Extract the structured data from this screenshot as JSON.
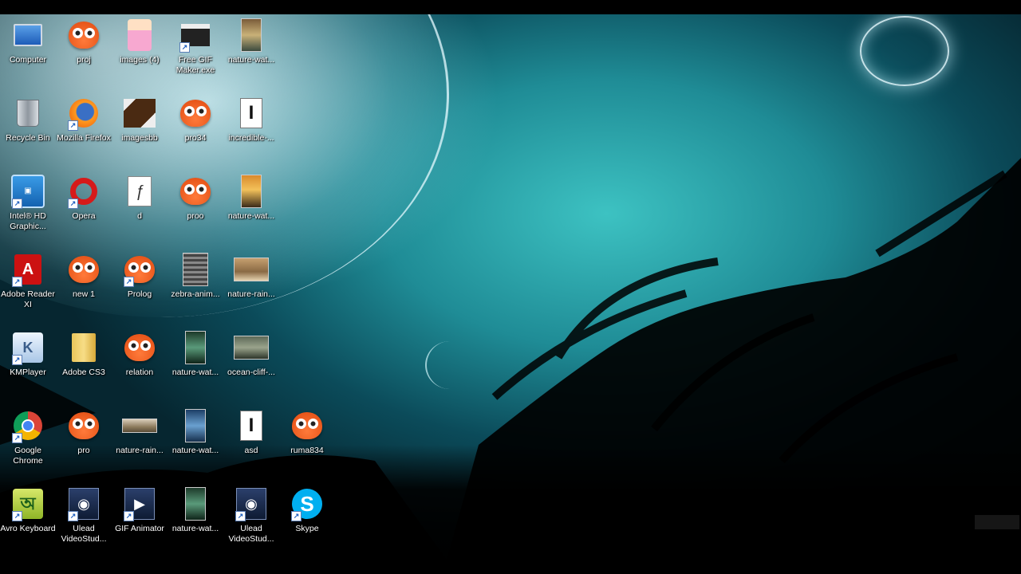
{
  "desktop": {
    "icons": [
      {
        "label": "Computer",
        "icon": "computer-icon",
        "shortcut": false
      },
      {
        "label": "proj",
        "icon": "owl-app-icon",
        "shortcut": false
      },
      {
        "label": "images (4)",
        "icon": "image-file-icon",
        "shortcut": false
      },
      {
        "label": "Free GIF Maker.exe",
        "icon": "clapperboard-icon",
        "shortcut": true
      },
      {
        "label": "nature-wat...",
        "icon": "image-file-icon",
        "shortcut": false
      },
      {
        "label": "Recycle Bin",
        "icon": "recycle-bin-icon",
        "shortcut": false
      },
      {
        "label": "Mozilla Firefox",
        "icon": "firefox-icon",
        "shortcut": true
      },
      {
        "label": "imagesbb",
        "icon": "image-file-icon",
        "shortcut": false
      },
      {
        "label": "pro34",
        "icon": "owl-app-icon",
        "shortcut": false
      },
      {
        "label": "incredible-...",
        "icon": "document-icon",
        "shortcut": false
      },
      {
        "label": "Intel® HD Graphic...",
        "icon": "intel-graphics-icon",
        "shortcut": true
      },
      {
        "label": "Opera",
        "icon": "opera-icon",
        "shortcut": true
      },
      {
        "label": "d",
        "icon": "flash-file-icon",
        "shortcut": false
      },
      {
        "label": "proo",
        "icon": "owl-app-icon",
        "shortcut": false
      },
      {
        "label": "nature-wat...",
        "icon": "image-file-icon",
        "shortcut": false
      },
      {
        "label": "Adobe Reader XI",
        "icon": "adobe-reader-icon",
        "shortcut": true
      },
      {
        "label": "new 1",
        "icon": "owl-app-icon",
        "shortcut": false
      },
      {
        "label": "Prolog",
        "icon": "owl-app-icon",
        "shortcut": true
      },
      {
        "label": "zebra-anim...",
        "icon": "image-file-icon",
        "shortcut": false
      },
      {
        "label": "nature-rain...",
        "icon": "image-file-icon",
        "shortcut": false
      },
      {
        "label": "KMPlayer",
        "icon": "kmplayer-icon",
        "shortcut": true
      },
      {
        "label": "Adobe CS3",
        "icon": "folder-icon",
        "shortcut": false
      },
      {
        "label": "relation",
        "icon": "owl-app-icon",
        "shortcut": false
      },
      {
        "label": "nature-wat...",
        "icon": "image-file-icon",
        "shortcut": false
      },
      {
        "label": "ocean-cliff-...",
        "icon": "image-file-icon",
        "shortcut": false
      },
      {
        "label": "Google Chrome",
        "icon": "chrome-icon",
        "shortcut": true
      },
      {
        "label": "pro",
        "icon": "owl-app-icon",
        "shortcut": false
      },
      {
        "label": "nature-rain...",
        "icon": "image-file-icon",
        "shortcut": false
      },
      {
        "label": "nature-wat...",
        "icon": "image-file-icon",
        "shortcut": false
      },
      {
        "label": "asd",
        "icon": "document-icon",
        "shortcut": false
      },
      {
        "label": "ruma834",
        "icon": "owl-app-icon",
        "shortcut": false
      },
      {
        "label": "Avro Keyboard",
        "icon": "avro-keyboard-icon",
        "shortcut": true
      },
      {
        "label": "Ulead VideoStud...",
        "icon": "ulead-video-icon",
        "shortcut": true
      },
      {
        "label": "GIF Animator",
        "icon": "gif-animator-icon",
        "shortcut": true
      },
      {
        "label": "nature-wat...",
        "icon": "image-file-icon",
        "shortcut": false
      },
      {
        "label": "Ulead VideoStud...",
        "icon": "ulead-video-icon",
        "shortcut": true
      },
      {
        "label": "Skype",
        "icon": "skype-icon",
        "shortcut": true
      }
    ]
  }
}
